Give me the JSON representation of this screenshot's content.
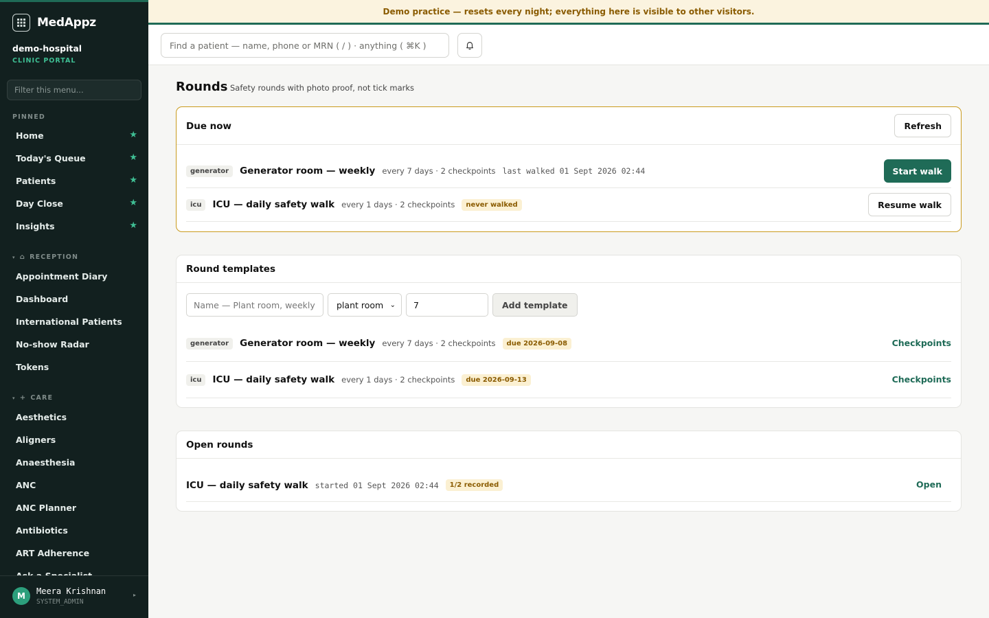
{
  "app": {
    "brand": "MedAppz",
    "org_name": "demo-hospital",
    "org_sub": "CLINIC PORTAL",
    "menu_filter_placeholder": "Filter this menu..."
  },
  "banner": "Demo practice — resets every night; everything here is visible to other visitors.",
  "topbar": {
    "search_placeholder": "Find a patient — name, phone or MRN ( / ) · anything ( ⌘K )",
    "bell_icon": "bell-icon"
  },
  "sidebar": {
    "pinned_label": "PINNED",
    "pinned": [
      {
        "label": "Home"
      },
      {
        "label": "Today's Queue"
      },
      {
        "label": "Patients"
      },
      {
        "label": "Day Close"
      },
      {
        "label": "Insights"
      }
    ],
    "reception_label": "RECEPTION",
    "reception": [
      {
        "label": "Appointment Diary"
      },
      {
        "label": "Dashboard"
      },
      {
        "label": "International Patients"
      },
      {
        "label": "No-show Radar"
      },
      {
        "label": "Tokens"
      }
    ],
    "care_label": "CARE",
    "care": [
      {
        "label": "Aesthetics"
      },
      {
        "label": "Aligners"
      },
      {
        "label": "Anaesthesia"
      },
      {
        "label": "ANC"
      },
      {
        "label": "ANC Planner"
      },
      {
        "label": "Antibiotics"
      },
      {
        "label": "ART Adherence"
      },
      {
        "label": "Ask a Specialist"
      }
    ]
  },
  "user": {
    "initial": "M",
    "name": "Meera Krishnan",
    "role": "SYSTEM_ADMIN"
  },
  "page": {
    "title": "Rounds",
    "subtitle": "Safety rounds with photo proof, not tick marks"
  },
  "due_now": {
    "title": "Due now",
    "refresh_label": "Refresh",
    "rows": [
      {
        "tag": "generator",
        "title": "Generator room — weekly",
        "meta": "every 7 days · 2 checkpoints",
        "status": "last walked 01 Sept 2026 02:44",
        "action": "Start walk"
      },
      {
        "tag": "icu",
        "title": "ICU — daily safety walk",
        "meta": "every 1 days · 2 checkpoints",
        "status": "never walked",
        "action": "Resume walk"
      }
    ]
  },
  "templates": {
    "title": "Round templates",
    "name_placeholder": "Name — Plant room, weekly",
    "type_value": "plant room",
    "interval_value": "7",
    "add_label": "Add template",
    "rows": [
      {
        "tag": "generator",
        "title": "Generator room — weekly",
        "meta": "every 7 days · 2 checkpoints",
        "due": "due 2026-09-08",
        "action": "Checkpoints"
      },
      {
        "tag": "icu",
        "title": "ICU — daily safety walk",
        "meta": "every 1 days · 2 checkpoints",
        "due": "due 2026-09-13",
        "action": "Checkpoints"
      }
    ]
  },
  "open_rounds": {
    "title": "Open rounds",
    "rows": [
      {
        "title": "ICU — daily safety walk",
        "started": "started 01 Sept 2026 02:44",
        "progress": "1/2 recorded",
        "action": "Open"
      }
    ]
  },
  "colors": {
    "accent": "#1f6b57",
    "sidebar_bg": "#12201f",
    "star": "#3fbf94",
    "warning_text": "#8a5b00",
    "warning_bg": "#fbf0d2"
  }
}
